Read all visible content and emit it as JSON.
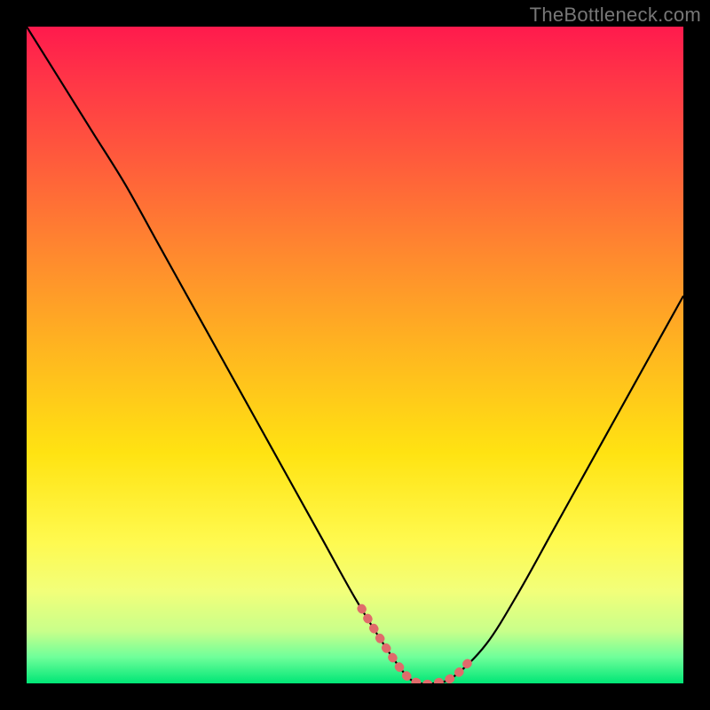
{
  "watermark": "TheBottleneck.com",
  "colors": {
    "background": "#000000",
    "gradient_top": "#ff1a4d",
    "gradient_mid": "#ffe312",
    "gradient_bottom": "#00e676",
    "curve_stroke": "#000000",
    "highlight_stroke": "#e06b6b"
  },
  "chart_data": {
    "type": "line",
    "title": "",
    "xlabel": "",
    "ylabel": "",
    "xlim": [
      0,
      100
    ],
    "ylim": [
      0,
      100
    ],
    "series": [
      {
        "name": "bottleneck-curve",
        "x": [
          0,
          5,
          10,
          15,
          20,
          25,
          30,
          35,
          40,
          45,
          50,
          55,
          58,
          60,
          62,
          65,
          70,
          75,
          80,
          85,
          90,
          95,
          100
        ],
        "values": [
          100,
          92,
          84,
          76,
          67,
          58,
          49,
          40,
          31,
          22,
          13,
          5,
          1,
          0,
          0,
          1,
          6,
          14,
          23,
          32,
          41,
          50,
          59
        ]
      }
    ],
    "highlight_range_x": [
      51,
      68
    ],
    "annotations": []
  }
}
